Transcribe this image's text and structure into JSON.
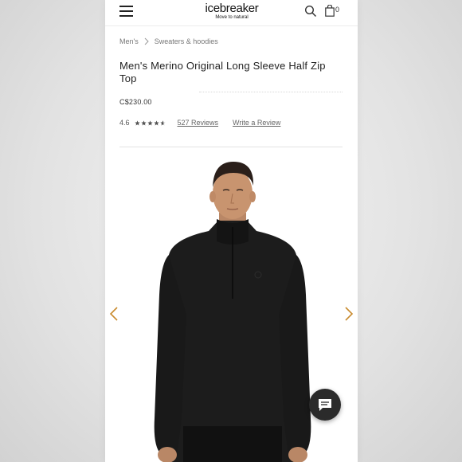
{
  "header": {
    "logo_main": "icebreaker",
    "logo_tagline": "Move to natural",
    "bag_count": "0",
    "icons": [
      "menu-icon",
      "search-icon",
      "bag-icon"
    ]
  },
  "breadcrumb": [
    "Men's",
    "Sweaters & hoodies"
  ],
  "product": {
    "title": "Men's Merino Original Long Sleeve Half Zip Top",
    "price": "C$230.00",
    "rating": "4.6",
    "rating_value": 4.6,
    "rating_max": 5,
    "reviews_link": "527 Reviews",
    "write_review_link": "Write a Review"
  },
  "gallery": {
    "icons": [
      "chevron-left-icon",
      "chevron-right-icon"
    ]
  },
  "chat": {
    "icon": "chat-icon"
  },
  "colors": {
    "accent": "#c98b2f",
    "text": "#222222",
    "garment": "#1b1b1b"
  }
}
